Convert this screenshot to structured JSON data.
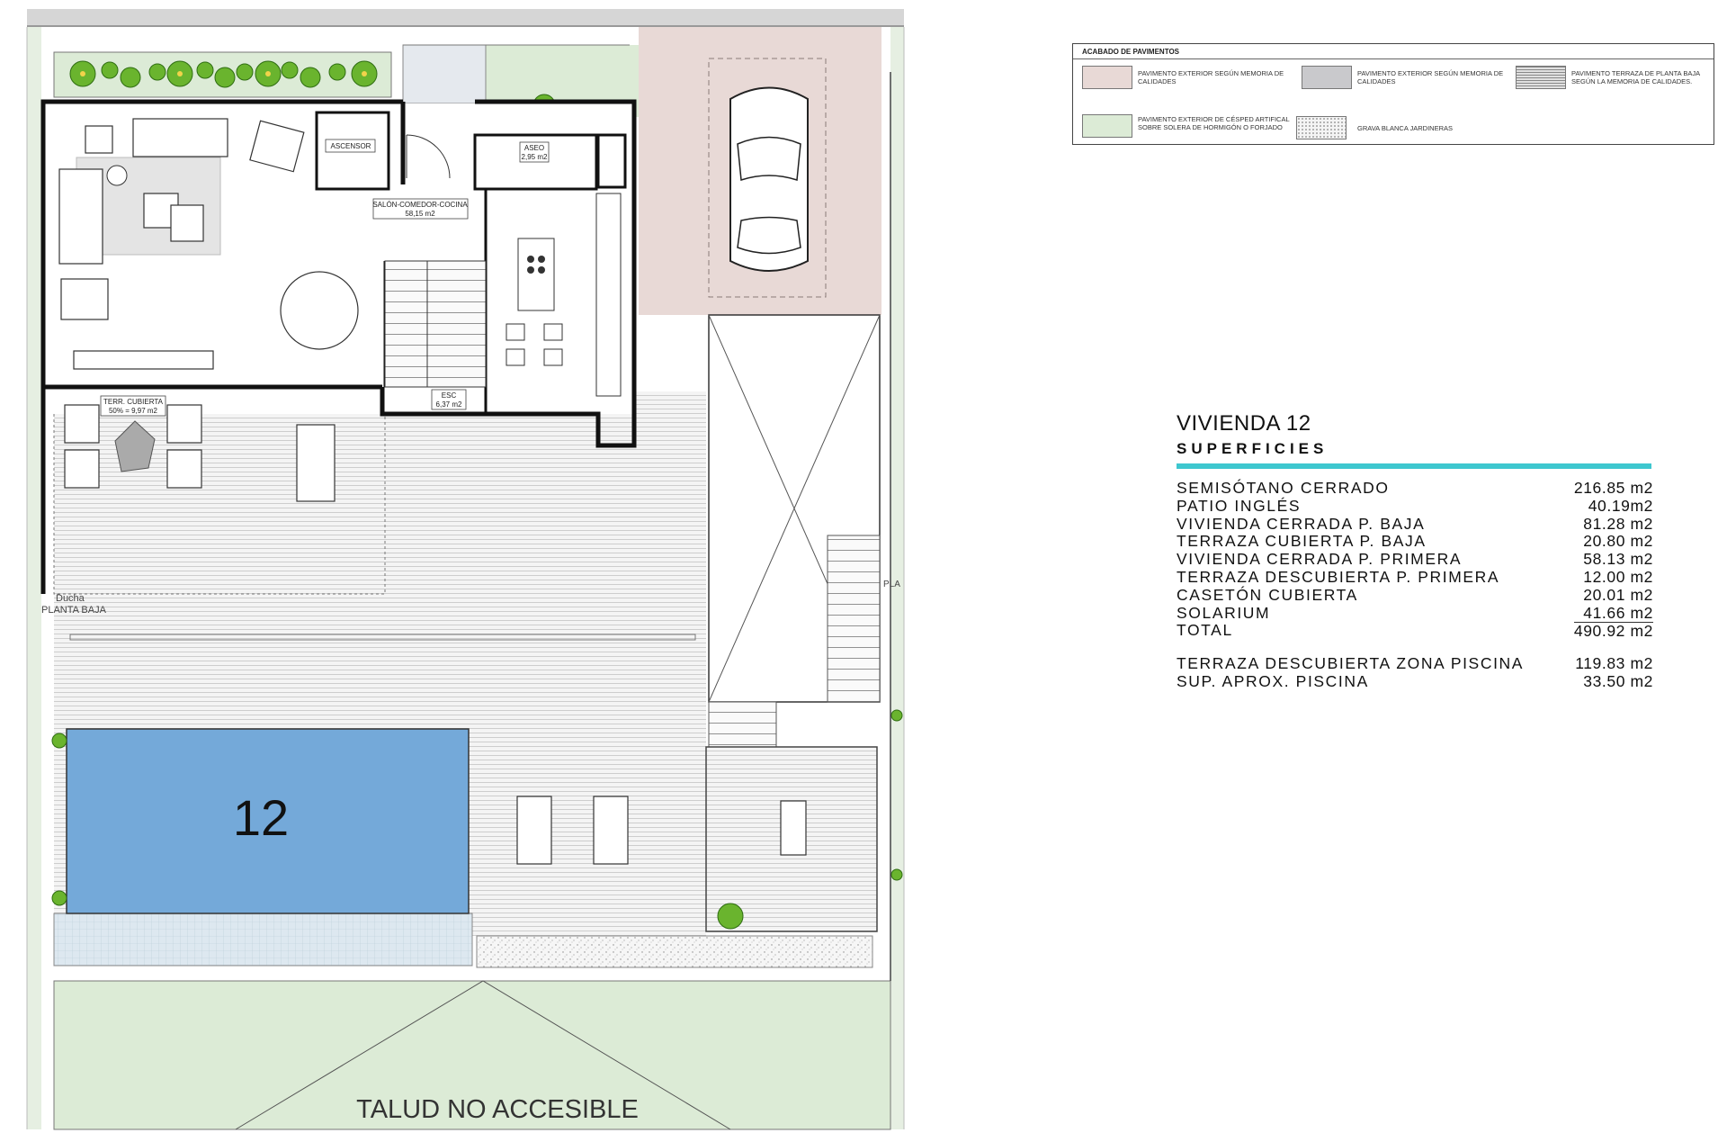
{
  "plan": {
    "pool_number": "12",
    "slope_label": "TALUD NO ACCESIBLE",
    "rooms": {
      "ascensor": "ASCENSOR",
      "aseo": "ASEO",
      "aseo_area": "2,95 m2",
      "salon": "SALÓN-COMEDOR-COCINA",
      "salon_area": "58,15 m2",
      "escalera": "ESC",
      "escalera_area": "6,37 m2",
      "terraza": "TERR. CUBIERTA",
      "terraza_area": "50% = 9,97 m2"
    },
    "ducha": "Ducha",
    "planta": "PLANTA BAJA",
    "edge_label": "PLA"
  },
  "legend": {
    "title": "ACABADO DE PAVIMENTOS",
    "items": [
      {
        "text": "PAVIMENTO EXTERIOR SEGÚN MEMORIA DE CALIDADES",
        "color": "#e8d9d6"
      },
      {
        "text": "PAVIMENTO EXTERIOR SEGÚN MEMORIA DE CALIDADES",
        "color": "#c9c9cc"
      },
      {
        "text": "PAVIMENTO TERRAZA DE PLANTA BAJA SEGÚN LA MEMORIA DE CALIDADES.",
        "color": "#e0e0e0"
      },
      {
        "text": "PAVIMENTO EXTERIOR DE CÉSPED ARTIFICAL SOBRE SOLERA DE HORMIGÓN O FORJADO",
        "color": "#dcebd6"
      },
      {
        "text": "GRAVA BLANCA JARDINERAS",
        "color": "#f2f2f2"
      }
    ]
  },
  "surfaces": {
    "title": "VIVIENDA 12",
    "subtitle": "SUPERFICIES",
    "rows": [
      {
        "label": "SEMISÓTANO CERRADO",
        "value": "216.85 m2"
      },
      {
        "label": "PATIO INGLÉS",
        "value": "40.19m2"
      },
      {
        "label": "VIVIENDA CERRADA P. BAJA",
        "value": "81.28 m2"
      },
      {
        "label": "TERRAZA CUBIERTA P. BAJA",
        "value": "20.80 m2"
      },
      {
        "label": "VIVIENDA CERRADA P. PRIMERA",
        "value": "58.13 m2"
      },
      {
        "label": "TERRAZA DESCUBIERTA P. PRIMERA",
        "value": "12.00 m2"
      },
      {
        "label": "CASETÓN CUBIERTA",
        "value": "20.01 m2"
      },
      {
        "label": "SOLARIUM",
        "value": "41.66 m2"
      },
      {
        "label": "TOTAL",
        "value": "490.92 m2"
      }
    ],
    "extra_rows": [
      {
        "label": "TERRAZA DESCUBIERTA  ZONA PISCINA",
        "value": "119.83 m2"
      },
      {
        "label": "SUP.  APROX.  PISCINA",
        "value": "33.50 m2"
      }
    ]
  },
  "colors": {
    "pool": "#74a9d9",
    "lawn": "#dcebd6",
    "paving": "#e8d9d6",
    "accent": "#3ec7cf"
  }
}
